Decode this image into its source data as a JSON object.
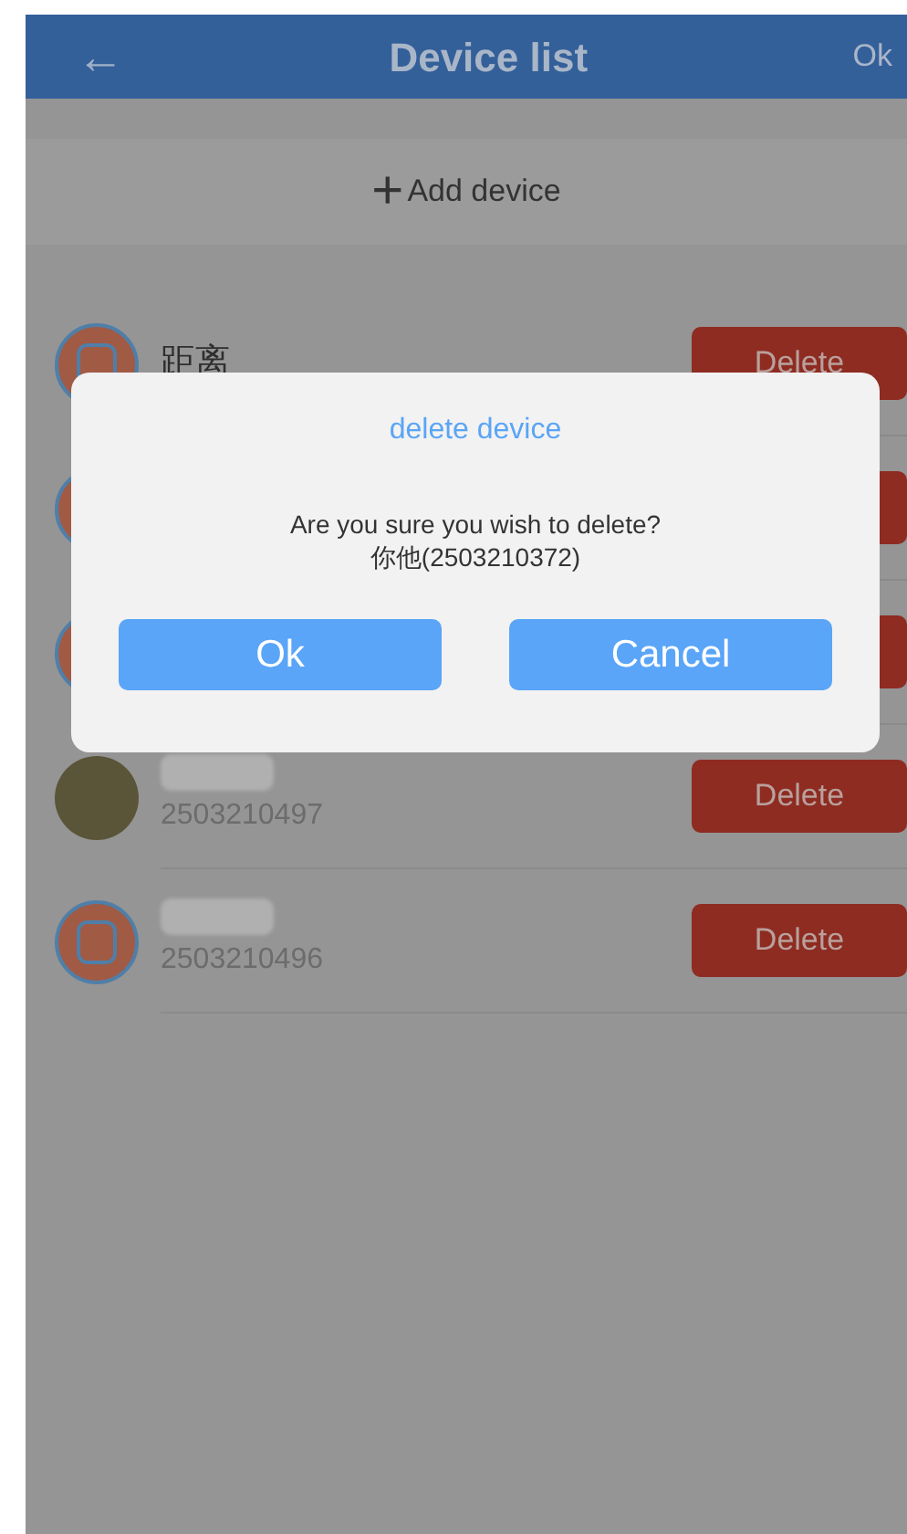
{
  "header": {
    "back": "←",
    "title": "Device list",
    "action": "Ok"
  },
  "add_device": {
    "icon": "+",
    "label": "Add device"
  },
  "devices": [
    {
      "kind": "gps",
      "name": "距离",
      "name_blurred": false,
      "delete": "Delete"
    },
    {
      "kind": "gps"
    },
    {
      "kind": "gps"
    },
    {
      "kind": "photo",
      "name_blurred": true,
      "id": "2503210497",
      "delete": "Delete"
    },
    {
      "kind": "gps",
      "name_blurred": true,
      "id": "2503210496",
      "delete": "Delete"
    }
  ],
  "dialog": {
    "title": "delete device",
    "message": "Are you sure you wish to delete?",
    "target": "你他(2503210372)",
    "buttons": [
      "Ok",
      "Cancel"
    ]
  }
}
